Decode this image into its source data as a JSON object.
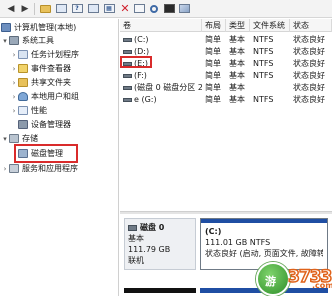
{
  "toolbar": {
    "icons": [
      "folder-icon",
      "console-tree-icon",
      "help-icon",
      "properties-icon",
      "help-topics-icon",
      "delete-icon",
      "check-icon",
      "search-icon",
      "command-prompt-icon",
      "format-icon"
    ]
  },
  "tree": {
    "root": "计算机管理(本地)",
    "system_tools": "系统工具",
    "task_scheduler": "任务计划程序",
    "event_viewer": "事件查看器",
    "shared_folders": "共享文件夹",
    "local_users": "本地用户和组",
    "performance": "性能",
    "device_manager": "设备管理器",
    "storage": "存储",
    "disk_management": "磁盘管理",
    "services": "服务和应用程序"
  },
  "volume_table": {
    "headers": [
      "卷",
      "布局",
      "类型",
      "文件系统",
      "状态"
    ],
    "rows": [
      {
        "volume": "(C:)",
        "layout": "简单",
        "type": "基本",
        "fs": "NTFS",
        "status": "状态良好"
      },
      {
        "volume": "(D:)",
        "layout": "简单",
        "type": "基本",
        "fs": "NTFS",
        "status": "状态良好"
      },
      {
        "volume": "(E:)",
        "layout": "简单",
        "type": "基本",
        "fs": "NTFS",
        "status": "状态良好"
      },
      {
        "volume": "(F:)",
        "layout": "简单",
        "type": "基本",
        "fs": "NTFS",
        "status": "状态良好"
      },
      {
        "volume": "(磁盘 0 磁盘分区 2)",
        "layout": "简单",
        "type": "基本",
        "fs": "",
        "status": "状态良好"
      },
      {
        "volume": "e (G:)",
        "layout": "简单",
        "type": "基本",
        "fs": "NTFS",
        "status": "状态良好"
      }
    ]
  },
  "disk": {
    "name": "磁盘 0",
    "kind": "基本",
    "size": "111.79 GB",
    "state": "联机",
    "partition_name": "(C:)",
    "partition_size": "111.01 GB NTFS",
    "partition_status": "状态良好 (启动, 页面文件, 故障转储, 主分区)"
  },
  "watermark": {
    "logo_text": "游",
    "number": "3733",
    "suffix": ".com"
  },
  "colors": {
    "highlight": "#d92b2b",
    "primary_partition": "#1f4ea3",
    "unallocated": "#111111"
  }
}
